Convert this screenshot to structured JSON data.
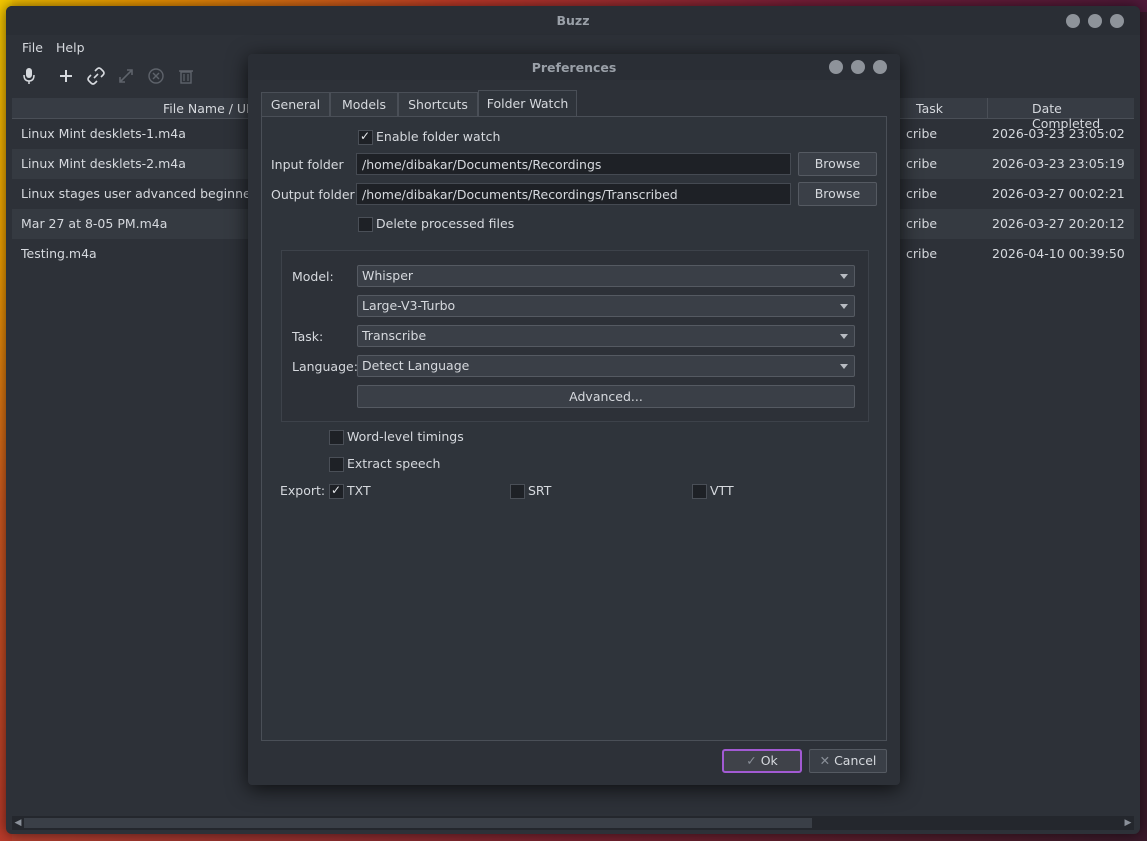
{
  "window": {
    "title": "Buzz"
  },
  "menu": {
    "file": "File",
    "help": "Help"
  },
  "table": {
    "headers": {
      "file_name": "File Name / UR",
      "task": "Task",
      "date_completed": "Date Completed"
    },
    "rows": [
      {
        "file": "Linux Mint desklets-1.m4a",
        "task": "cribe",
        "date": "2026-03-23 23:05:02"
      },
      {
        "file": "Linux Mint desklets-2.m4a",
        "task": "cribe",
        "date": "2026-03-23 23:05:19"
      },
      {
        "file": "Linux stages user advanced beginner..m",
        "task": "cribe",
        "date": "2026-03-27 00:02:21"
      },
      {
        "file": "Mar 27 at 8-05 PM.m4a",
        "task": "cribe",
        "date": "2026-03-27 20:20:12"
      },
      {
        "file": "Testing.m4a",
        "task": "cribe",
        "date": "2026-04-10 00:39:50"
      }
    ]
  },
  "dialog": {
    "title": "Preferences",
    "tabs": [
      "General",
      "Models",
      "Shortcuts",
      "Folder Watch"
    ],
    "enable_folder_watch": "Enable folder watch",
    "input_folder_label": "Input folder",
    "input_folder_value": "/home/dibakar/Documents/Recordings",
    "output_folder_label": "Output folder",
    "output_folder_value": "/home/dibakar/Documents/Recordings/Transcribed",
    "browse": "Browse",
    "delete_processed": "Delete processed files",
    "model_label": "Model:",
    "model_value": "Whisper",
    "model_size_value": "Large-V3-Turbo",
    "task_label": "Task:",
    "task_value": "Transcribe",
    "language_label": "Language:",
    "language_value": "Detect Language",
    "advanced": "Advanced...",
    "word_level": "Word-level timings",
    "extract_speech": "Extract speech",
    "export_label": "Export:",
    "export_txt": "TXT",
    "export_srt": "SRT",
    "export_vtt": "VTT",
    "ok": "Ok",
    "cancel": "Cancel"
  }
}
